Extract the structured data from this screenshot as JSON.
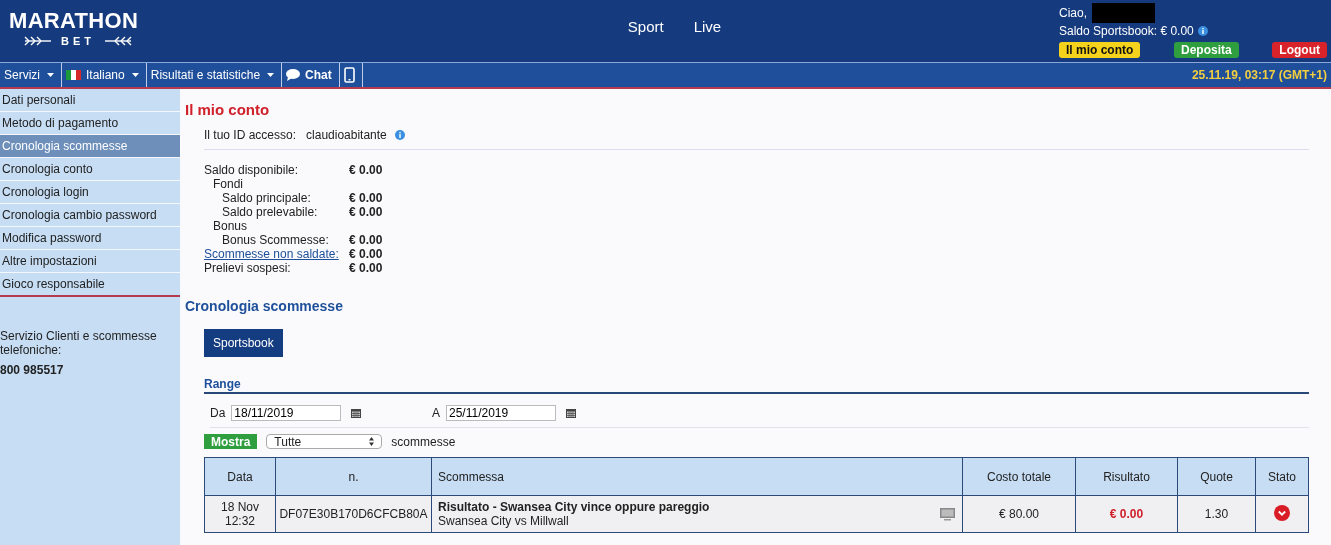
{
  "header": {
    "logo": {
      "title": "MARATHON",
      "subtitle": "BET"
    },
    "nav_links": [
      {
        "label": "Sport"
      },
      {
        "label": "Live"
      }
    ],
    "user": {
      "greeting": "Ciao,",
      "balance": "Saldo Sportsbook: € 0.00",
      "buttons": [
        {
          "label": "Il mio conto",
          "kind": "account"
        },
        {
          "label": "Deposita",
          "kind": "deposit"
        },
        {
          "label": "Logout",
          "kind": "logout"
        }
      ]
    }
  },
  "menu_bar": {
    "items": [
      {
        "label": "Servizi",
        "kind": "dropdown"
      },
      {
        "label": "Italiano",
        "kind": "language"
      },
      {
        "label": "Risultati e statistiche",
        "kind": "dropdown"
      },
      {
        "label": "Chat",
        "kind": "chat"
      },
      {
        "kind": "mobile"
      }
    ],
    "datetime": "25.11.19, 03:17 (GMT+1)"
  },
  "sidebar": {
    "items": [
      {
        "label": "Dati personali",
        "selected": false
      },
      {
        "label": "Metodo di pagamento",
        "selected": false
      },
      {
        "label": "Cronologia scommesse",
        "selected": true
      },
      {
        "label": "Cronologia conto",
        "selected": false
      },
      {
        "label": "Cronologia login",
        "selected": false
      },
      {
        "label": "Cronologia cambio password",
        "selected": false
      },
      {
        "label": "Modifica password",
        "selected": false
      },
      {
        "label": "Altre impostazioni",
        "selected": false
      },
      {
        "label": "Gioco responsabile",
        "selected": false
      }
    ],
    "contact_label": "Servizio Clienti e scommesse telefoniche:",
    "phone": "800 985517"
  },
  "main": {
    "title": "Il mio conto",
    "access_id": {
      "label": "Il tuo ID accesso:",
      "value": "claudioabitante"
    },
    "balances": [
      {
        "label": "Saldo disponibile:",
        "value": "€ 0.00",
        "link": false,
        "children": [
          {
            "label": "Fondi",
            "link": false,
            "children": [
              {
                "label": "Saldo principale:",
                "value": "€ 0.00",
                "link": false
              },
              {
                "label": "Saldo prelevabile:",
                "value": "€ 0.00",
                "link": false
              }
            ]
          },
          {
            "label": "Bonus",
            "link": false,
            "children": [
              {
                "label": "Bonus Scommesse:",
                "value": "€ 0.00",
                "link": false
              }
            ]
          }
        ]
      },
      {
        "label": "Scommesse non saldate:",
        "value": "€ 0.00",
        "link": true
      },
      {
        "label": "Prelievi sospesi:",
        "value": "€ 0.00",
        "link": false
      }
    ],
    "section_title": "Cronologia scommesse",
    "tabs": [
      {
        "label": "Sportsbook",
        "selected": true
      }
    ],
    "range": {
      "title": "Range",
      "from": {
        "label": "Da",
        "value": "18/11/2019"
      },
      "to": {
        "label": "A",
        "value": "25/11/2019"
      }
    },
    "filter": {
      "button": "Mostra",
      "select": "Tutte",
      "suffix": "scommesse"
    },
    "table": {
      "columns": [
        "Data",
        "n.",
        "Scommessa",
        "Costo totale",
        "Risultato",
        "Quote",
        "Stato"
      ],
      "rows": [
        {
          "date": "18 Nov",
          "time": "12:32",
          "number": "DF07E30B170D6CFCB80A",
          "bet_title": "Risultato - Swansea City vince oppure pareggio",
          "bet_match": "Swansea City vs Millwall",
          "cost": "€ 80.00",
          "result": "€ 0.00",
          "odds": "1.30",
          "lost": true
        }
      ]
    }
  }
}
